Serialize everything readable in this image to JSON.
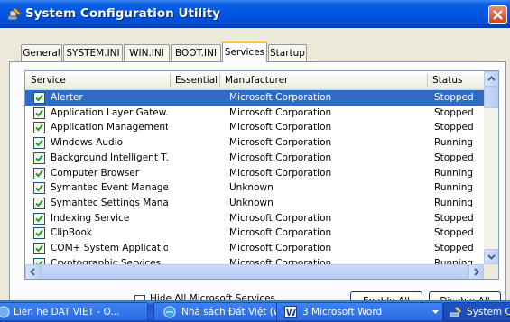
{
  "window": {
    "title": "System Configuration Utility"
  },
  "tabs": [
    {
      "label": "General"
    },
    {
      "label": "SYSTEM.INI"
    },
    {
      "label": "WIN.INI"
    },
    {
      "label": "BOOT.INI"
    },
    {
      "label": "Services",
      "active": true
    },
    {
      "label": "Startup"
    }
  ],
  "columns": {
    "service": "Service",
    "essential": "Essential",
    "manufacturer": "Manufacturer",
    "status": "Status"
  },
  "rows": [
    {
      "service": "Alerter",
      "essential": "",
      "manufacturer": "Microsoft Corporation",
      "status": "Stopped",
      "checked": true,
      "selected": true
    },
    {
      "service": "Application Layer Gatew...",
      "essential": "",
      "manufacturer": "Microsoft Corporation",
      "status": "Stopped",
      "checked": true
    },
    {
      "service": "Application Management",
      "essential": "",
      "manufacturer": "Microsoft Corporation",
      "status": "Stopped",
      "checked": true
    },
    {
      "service": "Windows Audio",
      "essential": "",
      "manufacturer": "Microsoft Corporation",
      "status": "Running",
      "checked": true
    },
    {
      "service": "Background Intelligent T...",
      "essential": "",
      "manufacturer": "Microsoft Corporation",
      "status": "Stopped",
      "checked": true
    },
    {
      "service": "Computer Browser",
      "essential": "",
      "manufacturer": "Microsoft Corporation",
      "status": "Running",
      "checked": true
    },
    {
      "service": "Symantec Event Manager",
      "essential": "",
      "manufacturer": "Unknown",
      "status": "Running",
      "checked": true
    },
    {
      "service": "Symantec Settings Mana...",
      "essential": "",
      "manufacturer": "Unknown",
      "status": "Running",
      "checked": true
    },
    {
      "service": "Indexing Service",
      "essential": "",
      "manufacturer": "Microsoft Corporation",
      "status": "Stopped",
      "checked": true
    },
    {
      "service": "ClipBook",
      "essential": "",
      "manufacturer": "Microsoft Corporation",
      "status": "Stopped",
      "checked": true
    },
    {
      "service": "COM+ System Application",
      "essential": "",
      "manufacturer": "Microsoft Corporation",
      "status": "Stopped",
      "checked": true
    },
    {
      "service": "Cryptographic Services",
      "essential": "",
      "manufacturer": "Microsoft Corporation",
      "status": "Running",
      "checked": true
    }
  ],
  "footer": {
    "hide_label": "Hide All Microsoft Services",
    "enable_all": "Enable All",
    "disable_all": "Disable All"
  },
  "taskbar": [
    {
      "label": "Lien he DAT VIET - O...",
      "icon": "browser-icon"
    },
    {
      "label": "Nhà sách Đất Việt (w...",
      "icon": "browser-icon"
    },
    {
      "label": "3 Microsoft Word",
      "icon": "word-icon"
    },
    {
      "label": "System Configu",
      "icon": "msconfig-icon",
      "active": true
    }
  ],
  "colors": {
    "selection": "#316ac5",
    "titlebar": "#0055e5",
    "taskbar": "#2663e0",
    "close": "#c3451f"
  }
}
